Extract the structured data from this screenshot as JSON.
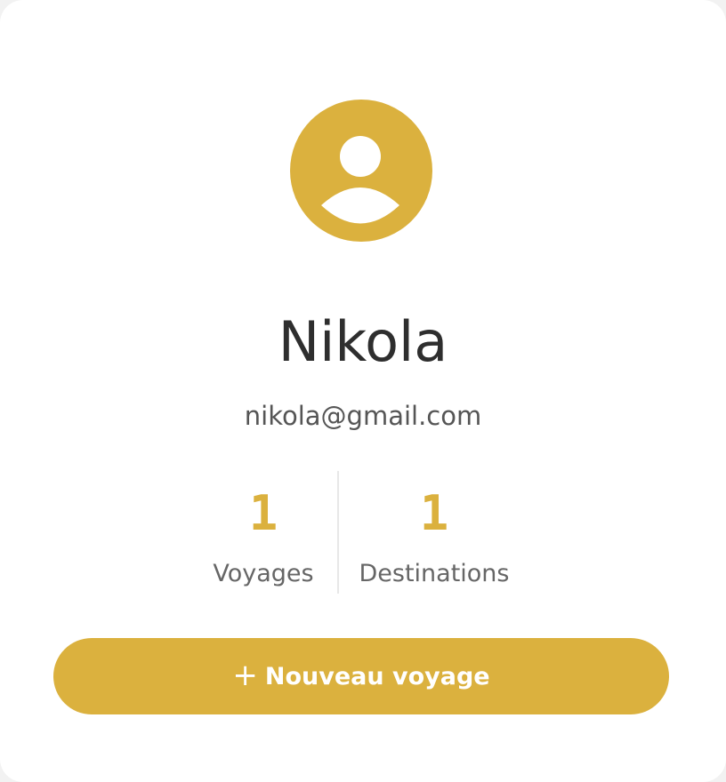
{
  "profile": {
    "avatar_icon": "user-avatar-icon",
    "name": "Nikola",
    "email": "nikola@gmail.com"
  },
  "stats": [
    {
      "value": "1",
      "label": "Voyages"
    },
    {
      "value": "1",
      "label": "Destinations"
    }
  ],
  "actions": {
    "new_trip_icon": "plus-icon",
    "new_trip_icon_glyph": "+",
    "new_trip_label": "Nouveau voyage"
  },
  "colors": {
    "accent": "#dbb13e",
    "background": "#f2f2f2",
    "card": "#ffffff",
    "text_primary": "#2e2e2e",
    "text_secondary": "#666666"
  }
}
